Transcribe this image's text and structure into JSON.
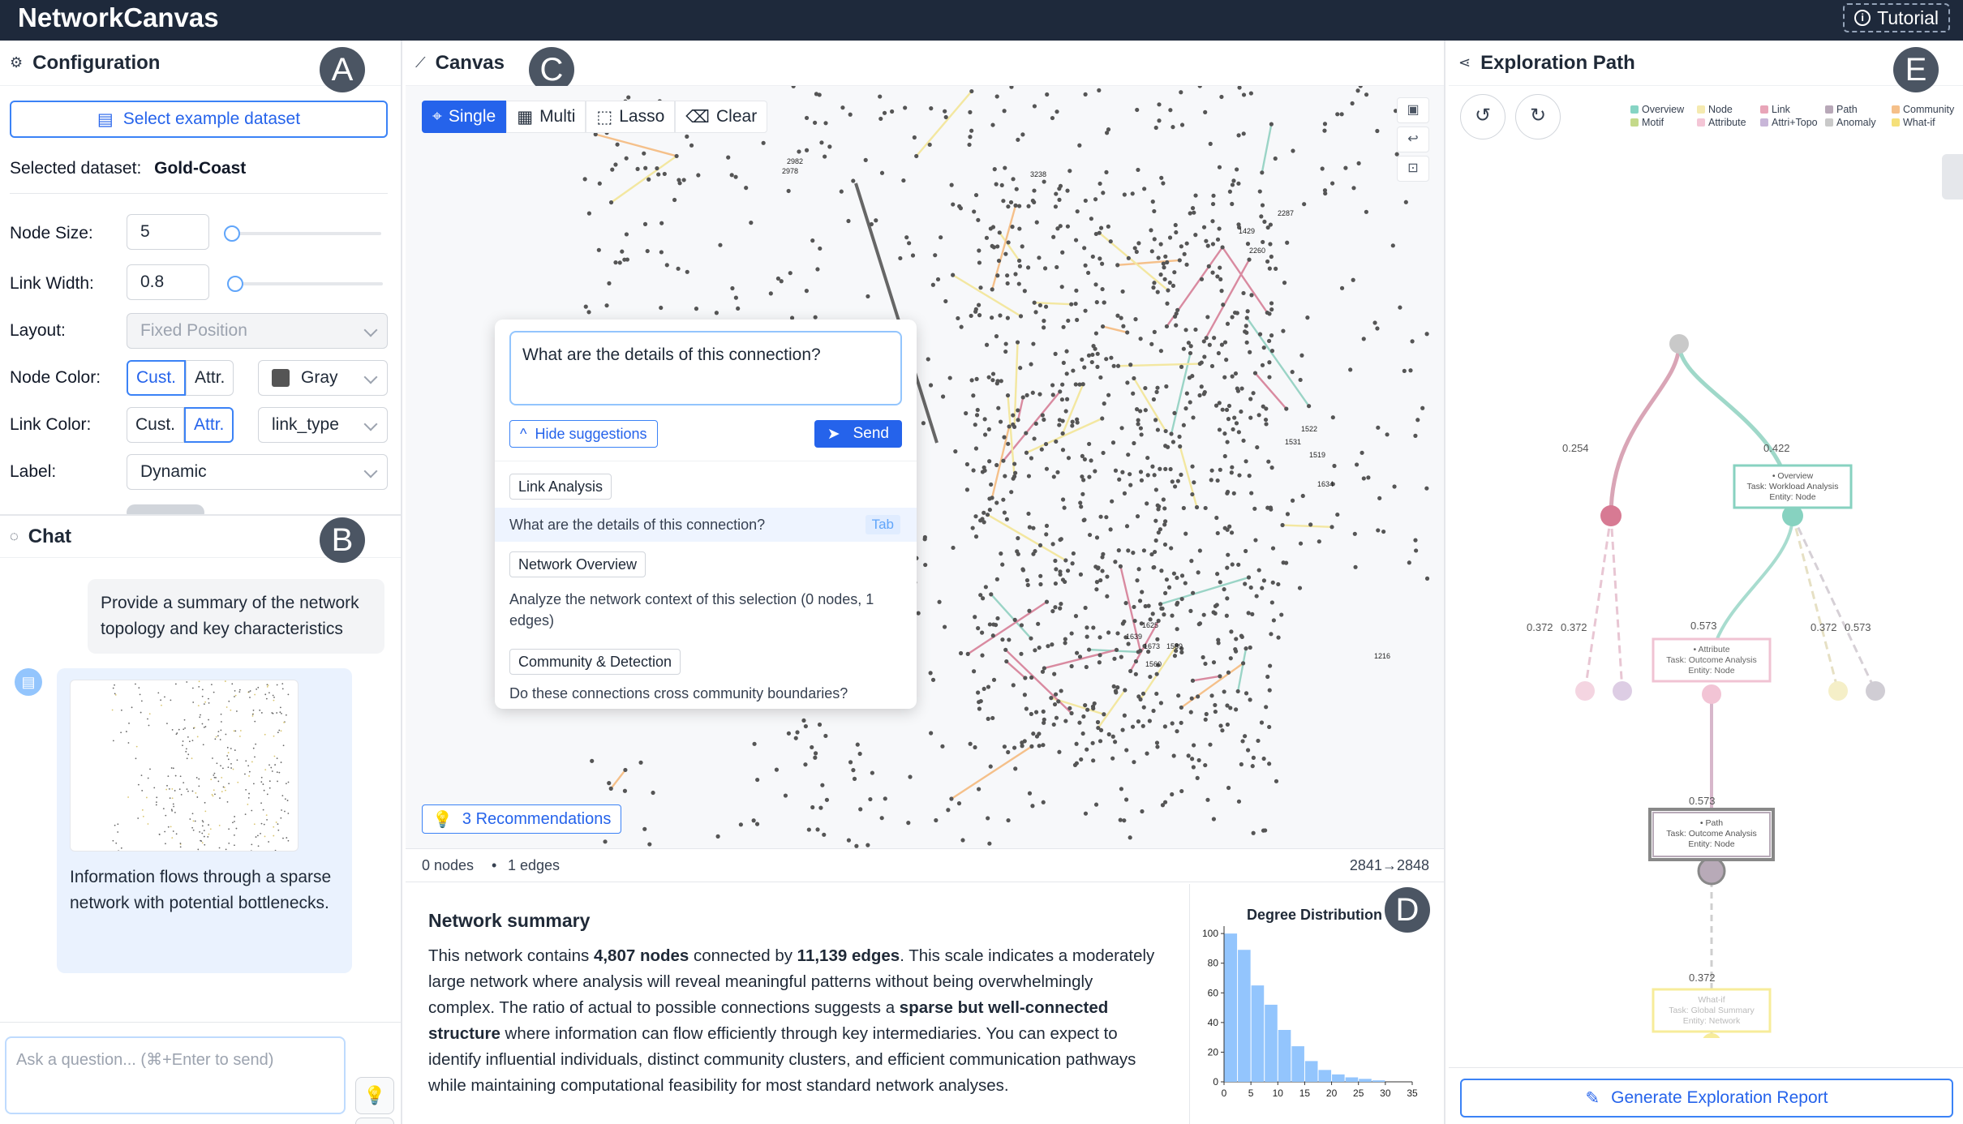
{
  "app": {
    "title": "NetworkCanvas",
    "tutorial_label": "Tutorial"
  },
  "config": {
    "title": "Configuration",
    "badge": "A",
    "select_dataset_label": "Select example dataset",
    "selected_dataset_label": "Selected dataset:",
    "selected_dataset_value": "Gold-Coast",
    "node_size_label": "Node Size:",
    "node_size_value": "5",
    "link_width_label": "Link Width:",
    "link_width_value": "0.8",
    "layout_label": "Layout:",
    "layout_value": "Fixed Position",
    "node_color_label": "Node Color:",
    "node_color_cust": "Cust.",
    "node_color_attr": "Attr.",
    "node_color_value": "Gray",
    "link_color_label": "Link Color:",
    "link_color_cust": "Cust.",
    "link_color_attr": "Attr.",
    "link_color_value": "link_type",
    "label_label": "Label:",
    "label_value": "Dynamic"
  },
  "chat": {
    "title": "Chat",
    "badge": "B",
    "user_message": "Provide a summary of the network topology and key characteristics",
    "ai_message": "Information flows through a sparse network with potential bottlenecks.",
    "input_placeholder": "Ask a question... (⌘+Enter to send)"
  },
  "canvas": {
    "title": "Canvas",
    "badge": "C",
    "tools": [
      "Single",
      "Multi",
      "Lasso",
      "Clear"
    ],
    "node_labels": [
      "2982",
      "2978",
      "3238",
      "2287",
      "1429",
      "2260",
      "1522",
      "1531",
      "1519",
      "1634",
      "1625",
      "1639",
      "1673",
      "1589",
      "1560",
      "1216"
    ],
    "popup": {
      "question": "What are the details of this connection?",
      "hide_label": "Hide suggestions",
      "send_label": "Send",
      "categories": [
        {
          "label": "Link Analysis",
          "suggestion": "What are the details of this connection?",
          "hint": "Tab"
        },
        {
          "label": "Network Overview",
          "suggestion": "Analyze the network context of this selection (0 nodes, 1 edges)"
        },
        {
          "label": "Community & Detection",
          "suggestion": "Do these connections cross community boundaries?"
        }
      ]
    },
    "recommendations_label": "3 Recommendations",
    "status_nodes": "0 nodes",
    "status_sep": "•",
    "status_edges": "1 edges",
    "status_selection": "2841→2848"
  },
  "summary": {
    "title": "Network summary",
    "p_intro": "This network contains ",
    "p_nodes": "4,807 nodes",
    "p_mid": " connected by ",
    "p_edges": "11,139 edges",
    "p_body": ". This scale indicates a moderately large network where analysis will reveal meaningful patterns without being overwhelmingly complex. The ratio of actual to possible connections suggests a ",
    "p_struct": "sparse but well-connected structure",
    "p_end": " where information can flow efficiently through key intermediaries. You can expect to identify influential individuals, distinct community clusters, and efficient communication pathways while maintaining computational feasibility for most standard network analyses."
  },
  "chart_data": {
    "type": "bar",
    "title": "Degree Distribution",
    "badge": "D",
    "bin_edges": [
      0,
      2.5,
      5,
      7.5,
      10,
      12.5,
      15,
      17.5,
      20,
      22.5,
      25,
      27.5,
      30,
      32.5,
      35
    ],
    "values": [
      100,
      89,
      65,
      52,
      35,
      24,
      14,
      8,
      5,
      3,
      2,
      1,
      0,
      0
    ],
    "xticks": [
      0,
      5,
      10,
      15,
      20,
      25,
      30,
      35
    ],
    "yticks": [
      0,
      20,
      40,
      60,
      80,
      100
    ],
    "ylim": [
      0,
      105
    ],
    "xlim": [
      0,
      35
    ],
    "bar_color": "#93c5fd"
  },
  "exploration": {
    "title": "Exploration Path",
    "badge": "E",
    "legend": [
      {
        "label": "Overview",
        "color": "#86d4c4"
      },
      {
        "label": "Node",
        "color": "#f5eab0"
      },
      {
        "label": "Link",
        "color": "#e8a5b8"
      },
      {
        "label": "Path",
        "color": "#b8a8b8"
      },
      {
        "label": "Community",
        "color": "#f5c08a"
      },
      {
        "label": "Motif",
        "color": "#c4d98a"
      },
      {
        "label": "Attribute",
        "color": "#f4c6d6"
      },
      {
        "label": "Attri+Topo",
        "color": "#c8b6d8"
      },
      {
        "label": "Anomaly",
        "color": "#c9c9c9"
      },
      {
        "label": "What-if",
        "color": "#f5e07a"
      }
    ],
    "scores": [
      "0.254",
      "0.422",
      "0.372",
      "0.372",
      "0.573",
      "0.372",
      "0.573",
      "0.573",
      "0.372"
    ],
    "cards": [
      {
        "title": "• Overview",
        "task": "Task: Workload Analysis",
        "entity": "Entity: Node"
      },
      {
        "title": "• Attribute",
        "task": "Task: Outcome Analysis",
        "entity": "Entity: Node"
      },
      {
        "title": "• Path",
        "task": "Task: Outcome Analysis",
        "entity": "Entity: Node"
      },
      {
        "title": "What-if",
        "task": "Task: Global Summary",
        "entity": "Entity: Network"
      }
    ],
    "generate_label": "Generate Exploration Report"
  },
  "colors": {
    "accent": "#2563eb",
    "topbar": "#1e293b"
  }
}
